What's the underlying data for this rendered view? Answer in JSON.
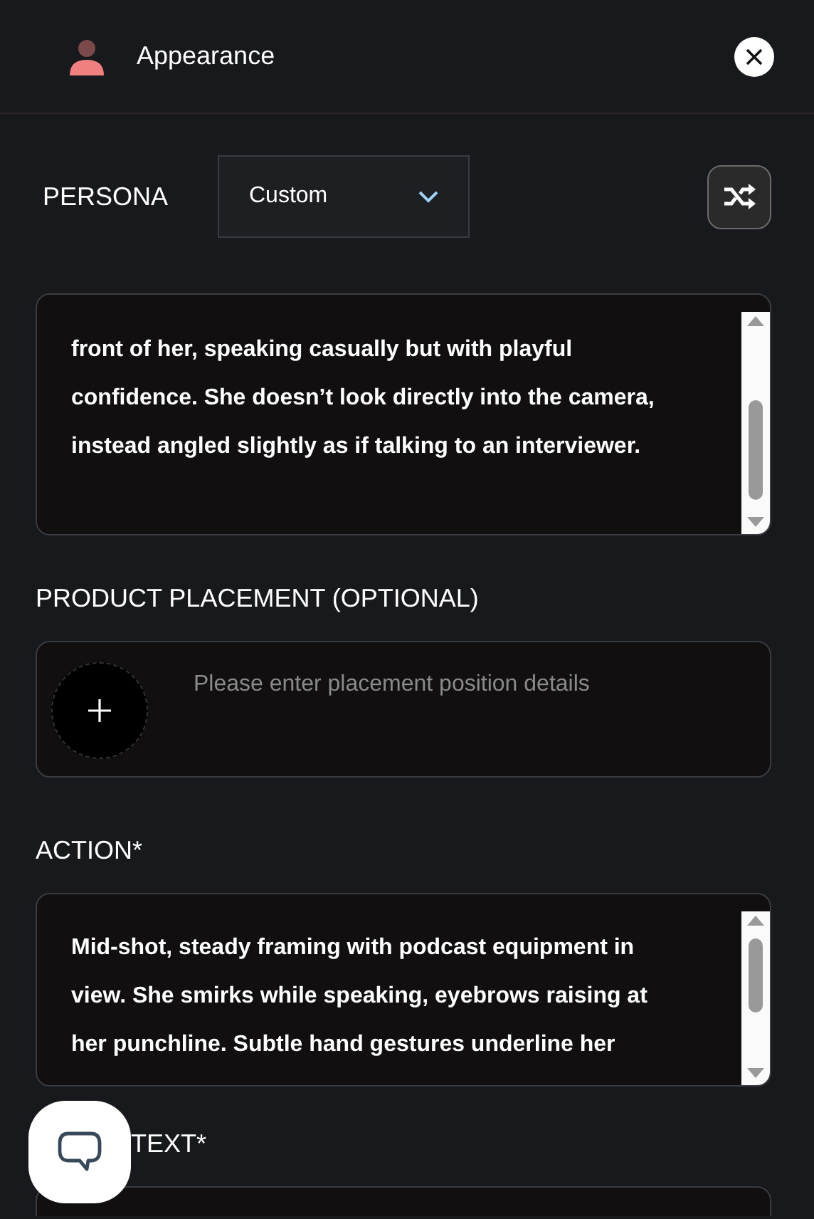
{
  "header": {
    "title": "Appearance"
  },
  "persona": {
    "label": "PERSONA",
    "value": "Custom"
  },
  "appearance_box": {
    "lines": [
      "front of her, speaking casually but with playful",
      "confidence. She doesn’t look directly into the camera,",
      "instead angled slightly as if talking to an interviewer."
    ]
  },
  "product_placement": {
    "label": "PRODUCT PLACEMENT (OPTIONAL)",
    "placeholder": "Please enter placement position details"
  },
  "action": {
    "label": "ACTION*",
    "lines": [
      "Mid-shot, steady framing with podcast equipment in",
      "view. She smirks while speaking, eyebrows raising at",
      "her punchline. Subtle hand gestures underline her"
    ]
  },
  "text": {
    "label": "TEXT*"
  }
}
